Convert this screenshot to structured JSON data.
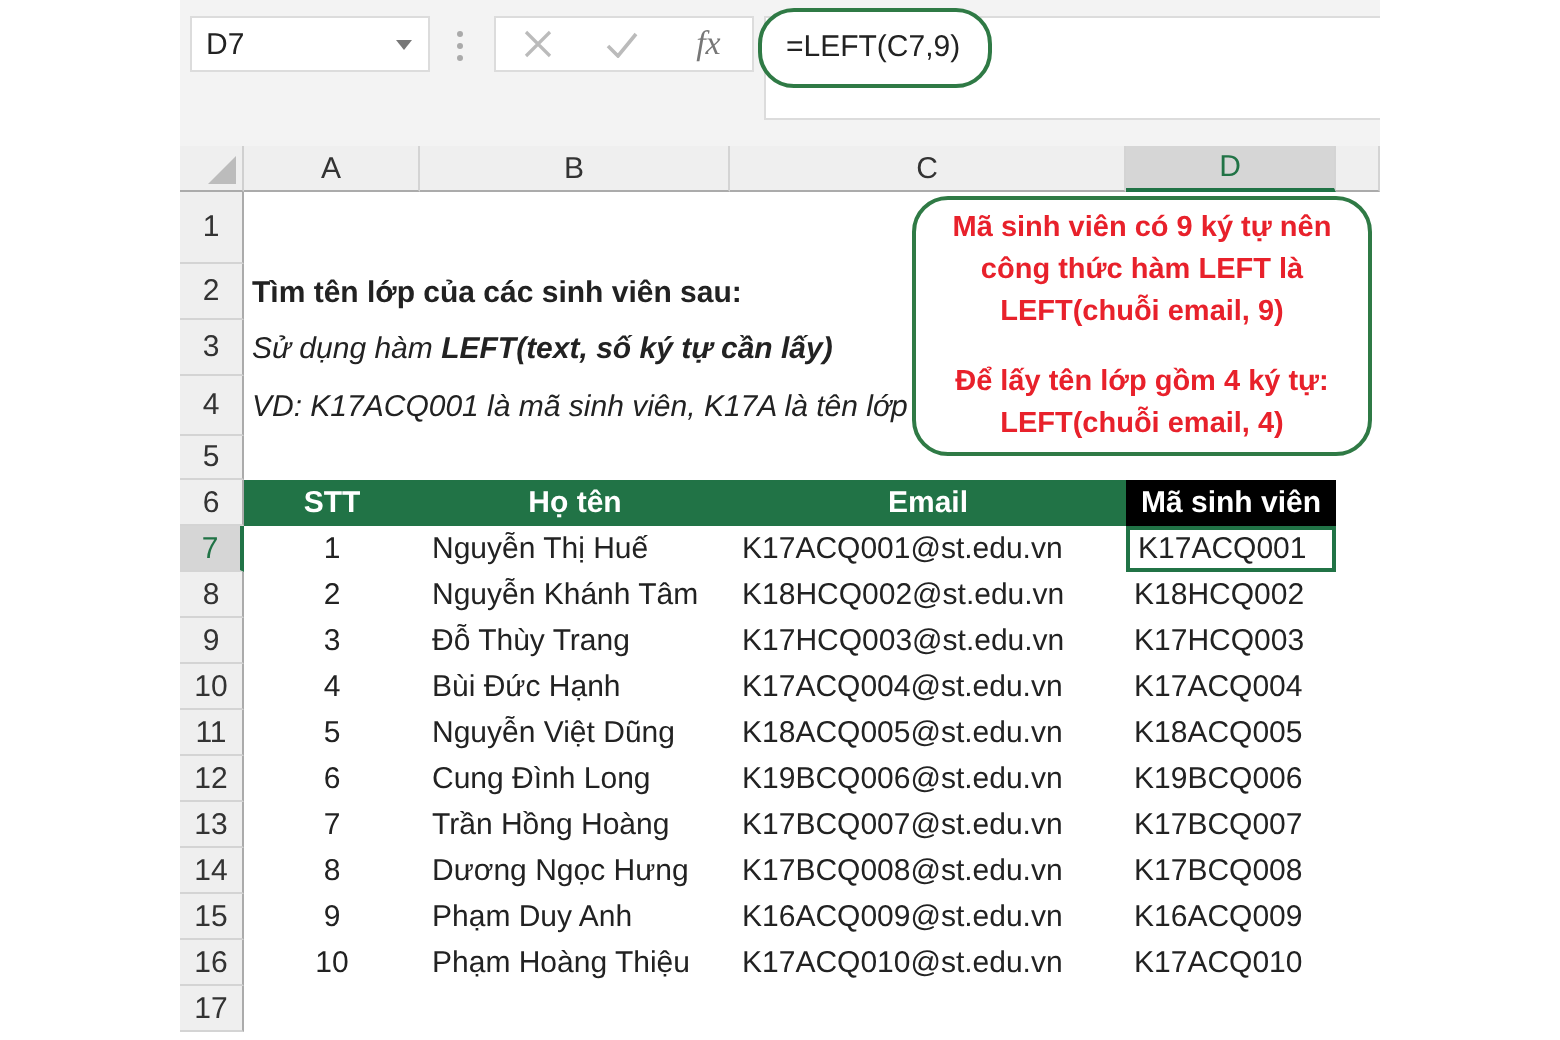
{
  "formula_bar": {
    "name_box": "D7",
    "function_label": "fx",
    "formula": "=LEFT(C7,9)"
  },
  "columns": [
    {
      "label": "A",
      "selected": false
    },
    {
      "label": "B",
      "selected": false
    },
    {
      "label": "C",
      "selected": false
    },
    {
      "label": "D",
      "selected": true
    }
  ],
  "row_headers": [
    {
      "label": "1",
      "selected": false
    },
    {
      "label": "2",
      "selected": false
    },
    {
      "label": "3",
      "selected": false
    },
    {
      "label": "4",
      "selected": false
    },
    {
      "label": "5",
      "selected": false
    },
    {
      "label": "6",
      "selected": false
    },
    {
      "label": "7",
      "selected": true
    },
    {
      "label": "8",
      "selected": false
    },
    {
      "label": "9",
      "selected": false
    },
    {
      "label": "10",
      "selected": false
    },
    {
      "label": "11",
      "selected": false
    },
    {
      "label": "12",
      "selected": false
    },
    {
      "label": "13",
      "selected": false
    },
    {
      "label": "14",
      "selected": false
    },
    {
      "label": "15",
      "selected": false
    },
    {
      "label": "16",
      "selected": false
    },
    {
      "label": "17",
      "selected": false
    }
  ],
  "notes": [
    {
      "kind": "bold",
      "text": "Tìm tên lớp của các sinh viên sau:"
    },
    {
      "kind": "italic",
      "text": "Sử dụng hàm  **LEFT(text, số ký tự cần lấy)**"
    },
    {
      "kind": "italic",
      "text": "VD: K17ACQ001 là mã sinh viên, K17A là tên lớp"
    }
  ],
  "callout": [
    "Mã sinh viên có 9 ký tự nên công thức hàm LEFT là LEFT(chuỗi email, 9)",
    "Để lấy tên lớp gồm 4 ký tự: LEFT(chuỗi email, 4)"
  ],
  "table": {
    "header": [
      {
        "label": "STT",
        "highlighted": false
      },
      {
        "label": "Họ tên",
        "highlighted": false
      },
      {
        "label": "Email",
        "highlighted": false
      },
      {
        "label": "Mã sinh viên",
        "highlighted": true
      }
    ],
    "rows": [
      {
        "stt": "1",
        "name": "Nguyễn Thị Huế",
        "email": "K17ACQ001@st.edu.vn",
        "code": "K17ACQ001",
        "selected": true
      },
      {
        "stt": "2",
        "name": "Nguyễn Khánh Tâm",
        "email": "K18HCQ002@st.edu.vn",
        "code": "K18HCQ002",
        "selected": false
      },
      {
        "stt": "3",
        "name": "Đỗ Thùy Trang",
        "email": "K17HCQ003@st.edu.vn",
        "code": "K17HCQ003",
        "selected": false
      },
      {
        "stt": "4",
        "name": "Bùi Đức Hạnh",
        "email": "K17ACQ004@st.edu.vn",
        "code": "K17ACQ004",
        "selected": false
      },
      {
        "stt": "5",
        "name": "Nguyễn Việt Dũng",
        "email": "K18ACQ005@st.edu.vn",
        "code": "K18ACQ005",
        "selected": false
      },
      {
        "stt": "6",
        "name": "Cung Đình Long",
        "email": "K19BCQ006@st.edu.vn",
        "code": "K19BCQ006",
        "selected": false
      },
      {
        "stt": "7",
        "name": "Trần Hồng Hoàng",
        "email": "K17BCQ007@st.edu.vn",
        "code": "K17BCQ007",
        "selected": false
      },
      {
        "stt": "8",
        "name": "Dương Ngọc Hưng",
        "email": "K17BCQ008@st.edu.vn",
        "code": "K17BCQ008",
        "selected": false
      },
      {
        "stt": "9",
        "name": "Phạm Duy Anh",
        "email": "K16ACQ009@st.edu.vn",
        "code": "K16ACQ009",
        "selected": false
      },
      {
        "stt": "10",
        "name": "Phạm Hoàng Thiệu",
        "email": "K17ACQ010@st.edu.vn",
        "code": "K17ACQ010",
        "selected": false
      }
    ]
  }
}
